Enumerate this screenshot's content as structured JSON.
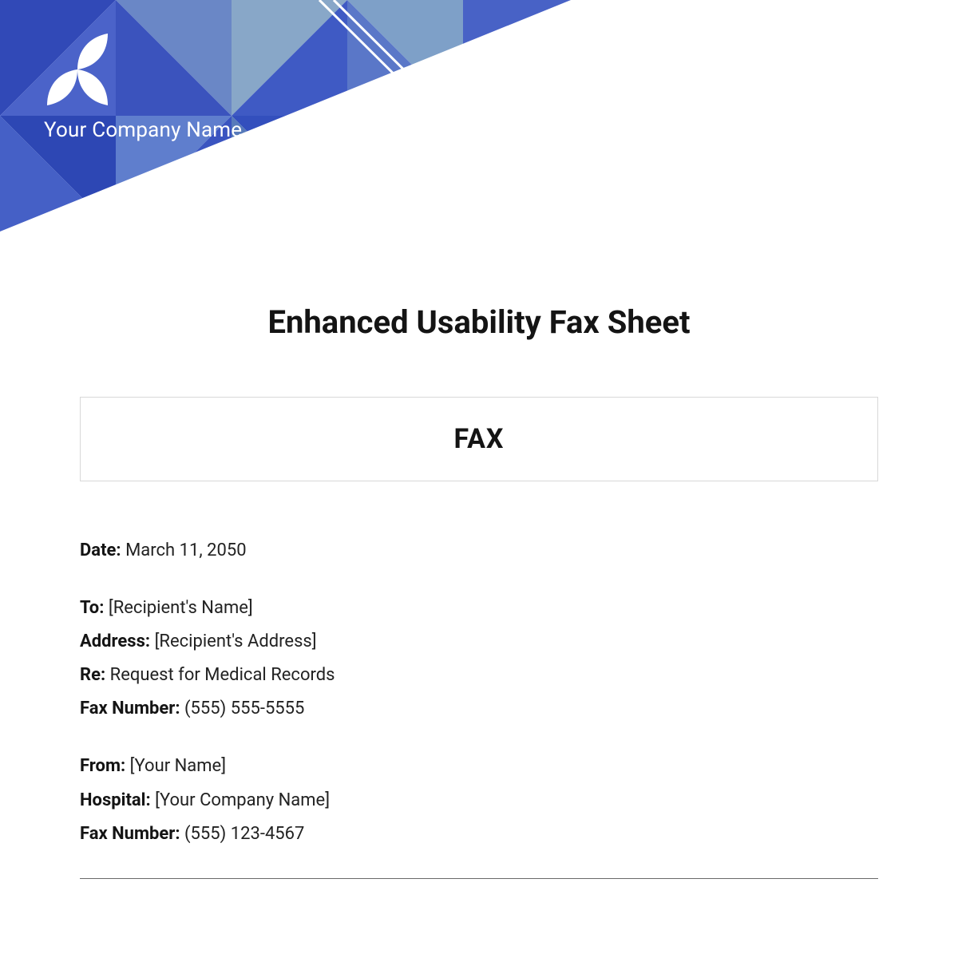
{
  "header": {
    "company_name": "Your Company Name"
  },
  "document": {
    "title": "Enhanced Usability Fax Sheet",
    "fax_heading": "FAX"
  },
  "fields": {
    "date": {
      "label": "Date:",
      "value": "March 11, 2050"
    },
    "to_block": {
      "to": {
        "label": "To:",
        "value": "[Recipient's Name]"
      },
      "address": {
        "label": "Address:",
        "value": "[Recipient's Address]"
      },
      "re": {
        "label": "Re:",
        "value": "Request for Medical Records"
      },
      "fax_number": {
        "label": "Fax Number:",
        "value": "(555) 555-5555"
      }
    },
    "from_block": {
      "from": {
        "label": "From:",
        "value": "[Your Name]"
      },
      "hospital": {
        "label": "Hospital:",
        "value": "[Your Company Name]"
      },
      "fax_number": {
        "label": "Fax Number:",
        "value": "(555) 123-4567"
      }
    }
  }
}
